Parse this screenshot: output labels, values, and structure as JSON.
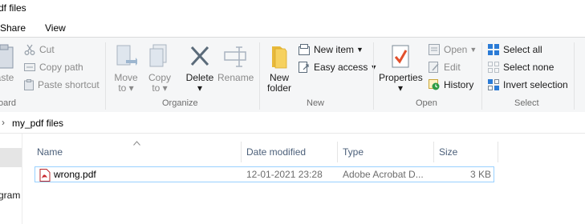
{
  "window": {
    "title": "df files"
  },
  "tabs": {
    "share": "Share",
    "view": "View"
  },
  "ribbon": {
    "clipboard": {
      "paste_partial": "aste",
      "cut": "Cut",
      "copy_path": "Copy path",
      "paste_shortcut": "Paste shortcut",
      "group_partial": "oard"
    },
    "organize": {
      "move_to": "Move",
      "move_to_sub": "to ▾",
      "copy_to": "Copy",
      "copy_to_sub": "to ▾",
      "delete": "Delete",
      "delete_sub": "▾",
      "rename": "Rename",
      "group": "Organize"
    },
    "new": {
      "new_folder_1": "New",
      "new_folder_2": "folder",
      "new_item": "New item",
      "easy_access": "Easy access",
      "group": "New"
    },
    "open": {
      "properties": "Properties",
      "properties_sub": "▾",
      "open": "Open",
      "edit": "Edit",
      "history": "History",
      "group": "Open"
    },
    "select": {
      "select_all": "Select all",
      "select_none": "Select none",
      "invert_selection": "Invert selection",
      "group": "Select"
    }
  },
  "address": {
    "chevron": "›",
    "path": "my_pdf files"
  },
  "nav_pane": {
    "partial_label": "gram"
  },
  "columns": {
    "name": "Name",
    "date_modified": "Date modified",
    "type": "Type",
    "size": "Size"
  },
  "files": [
    {
      "name": "wrong.pdf",
      "date_modified": "12-01-2021 23:28",
      "type": "Adobe Acrobat D...",
      "size": "3 KB"
    }
  ],
  "colors": {
    "accent": "#0078d7",
    "selection_border": "#99d1ff",
    "ribbon_bg": "#f5f6f7",
    "header_text": "#4c607a"
  }
}
